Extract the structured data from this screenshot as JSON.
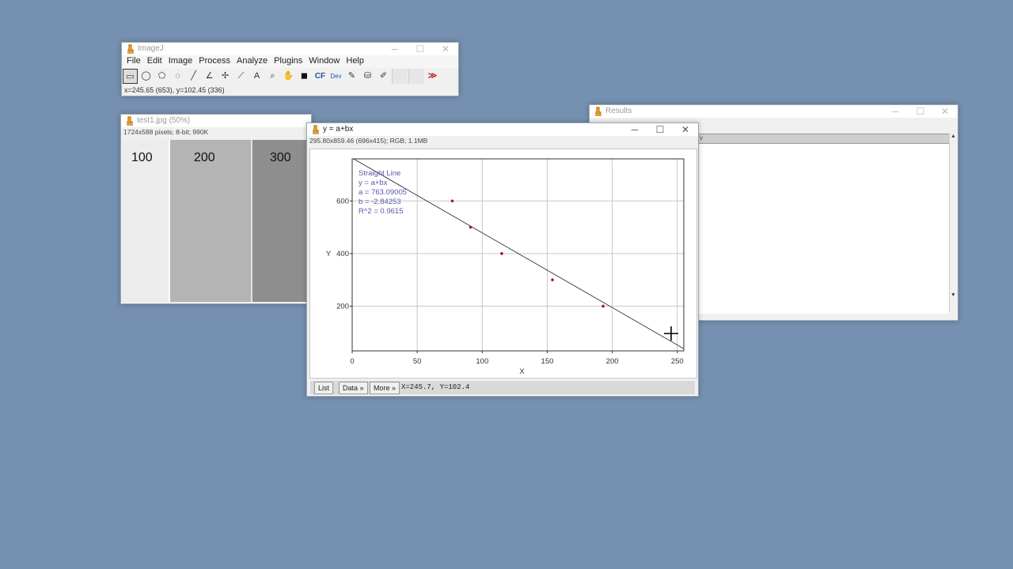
{
  "imagej": {
    "title": "ImageJ",
    "menu": [
      "File",
      "Edit",
      "Image",
      "Process",
      "Analyze",
      "Plugins",
      "Window",
      "Help"
    ],
    "tools": [
      {
        "name": "rectangle-tool-icon",
        "glyph": "▭",
        "selected": true
      },
      {
        "name": "oval-tool-icon",
        "glyph": "◯"
      },
      {
        "name": "polygon-tool-icon",
        "glyph": "⬠"
      },
      {
        "name": "freehand-tool-icon",
        "glyph": "◌"
      },
      {
        "name": "line-tool-icon",
        "glyph": "╱"
      },
      {
        "name": "angle-tool-icon",
        "glyph": "∠"
      },
      {
        "name": "point-tool-icon",
        "glyph": "✢"
      },
      {
        "name": "wand-tool-icon",
        "glyph": "⟋"
      },
      {
        "name": "text-tool-icon",
        "glyph": "A"
      },
      {
        "name": "magnifier-tool-icon",
        "glyph": "⌕"
      },
      {
        "name": "hand-tool-icon",
        "glyph": "✋"
      },
      {
        "name": "color-picker-tool-icon",
        "glyph": "◼"
      },
      {
        "name": "cf-tool-icon",
        "glyph": "CF"
      },
      {
        "name": "developer-menu-icon",
        "glyph": "Dev"
      },
      {
        "name": "brush-tool-icon",
        "glyph": "✎"
      },
      {
        "name": "flood-fill-tool-icon",
        "glyph": "⛁"
      },
      {
        "name": "pencil-tool-icon",
        "glyph": "✐"
      },
      {
        "name": "blank-slot-icon",
        "glyph": ""
      },
      {
        "name": "blank-slot-icon",
        "glyph": ""
      },
      {
        "name": "more-tools-icon",
        "glyph": "≫"
      }
    ],
    "status": "x=245.65 (653), y=102.45 (336)"
  },
  "image_window": {
    "title": "test1.jpg (50%)",
    "subtitle": "1724x588 pixels; 8-bit; 990K",
    "bands": [
      "100",
      "200",
      "300"
    ]
  },
  "plot_window": {
    "title": "y = a+bx",
    "subtitle": "295.80x859.46  (696x415); RGB; 1.1MB",
    "buttons": {
      "list": "List",
      "data": "Data »",
      "more": "More »"
    },
    "coords": "X=245.7, Y=102.4"
  },
  "results_window": {
    "title": "Results",
    "column_header": "v"
  },
  "chart_data": {
    "type": "scatter",
    "title": "",
    "xlabel": "X",
    "ylabel": "Y",
    "xlim": [
      0,
      255
    ],
    "ylim": [
      30,
      760
    ],
    "x_ticks": [
      0,
      50,
      100,
      150,
      200,
      250
    ],
    "y_ticks": [
      200,
      400,
      600
    ],
    "grid": true,
    "series": [
      {
        "type": "scatter",
        "x": [
          77,
          91,
          115,
          154,
          193
        ],
        "y": [
          600,
          500,
          400,
          300,
          200
        ],
        "color": "#a01818"
      }
    ],
    "fit": {
      "a": 763.09005,
      "b": -2.84253
    },
    "legend": [
      "Straight Line",
      "y = a+bx",
      "a = 763.09005",
      "b = -2.84253",
      "R^2 = 0.9615"
    ]
  }
}
